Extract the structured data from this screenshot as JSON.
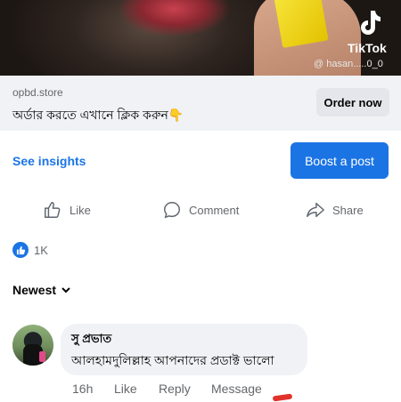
{
  "video": {
    "watermark_brand": "TikTok",
    "watermark_user": "@ hasan.....0_0"
  },
  "link_preview": {
    "domain": "opbd.store",
    "headline": "অর্ডার করতে এখানে ক্লিক করুন👇",
    "cta_label": "Order now"
  },
  "insights": {
    "see_insights_label": "See insights",
    "boost_label": "Boost a post"
  },
  "actions": {
    "like_label": "Like",
    "comment_label": "Comment",
    "share_label": "Share"
  },
  "reactions": {
    "count": "1K"
  },
  "comments_sort": {
    "label": "Newest"
  },
  "comment": {
    "author": "সু প্রভাত",
    "text": "আলহামদুলিল্লাহ আপনাদের প্রডাক্ট ভালো",
    "time": "16h",
    "like_label": "Like",
    "reply_label": "Reply",
    "message_label": "Message"
  },
  "colors": {
    "accent": "#1b74e4",
    "muted_text": "#65676b",
    "surface": "#f0f2f5"
  }
}
